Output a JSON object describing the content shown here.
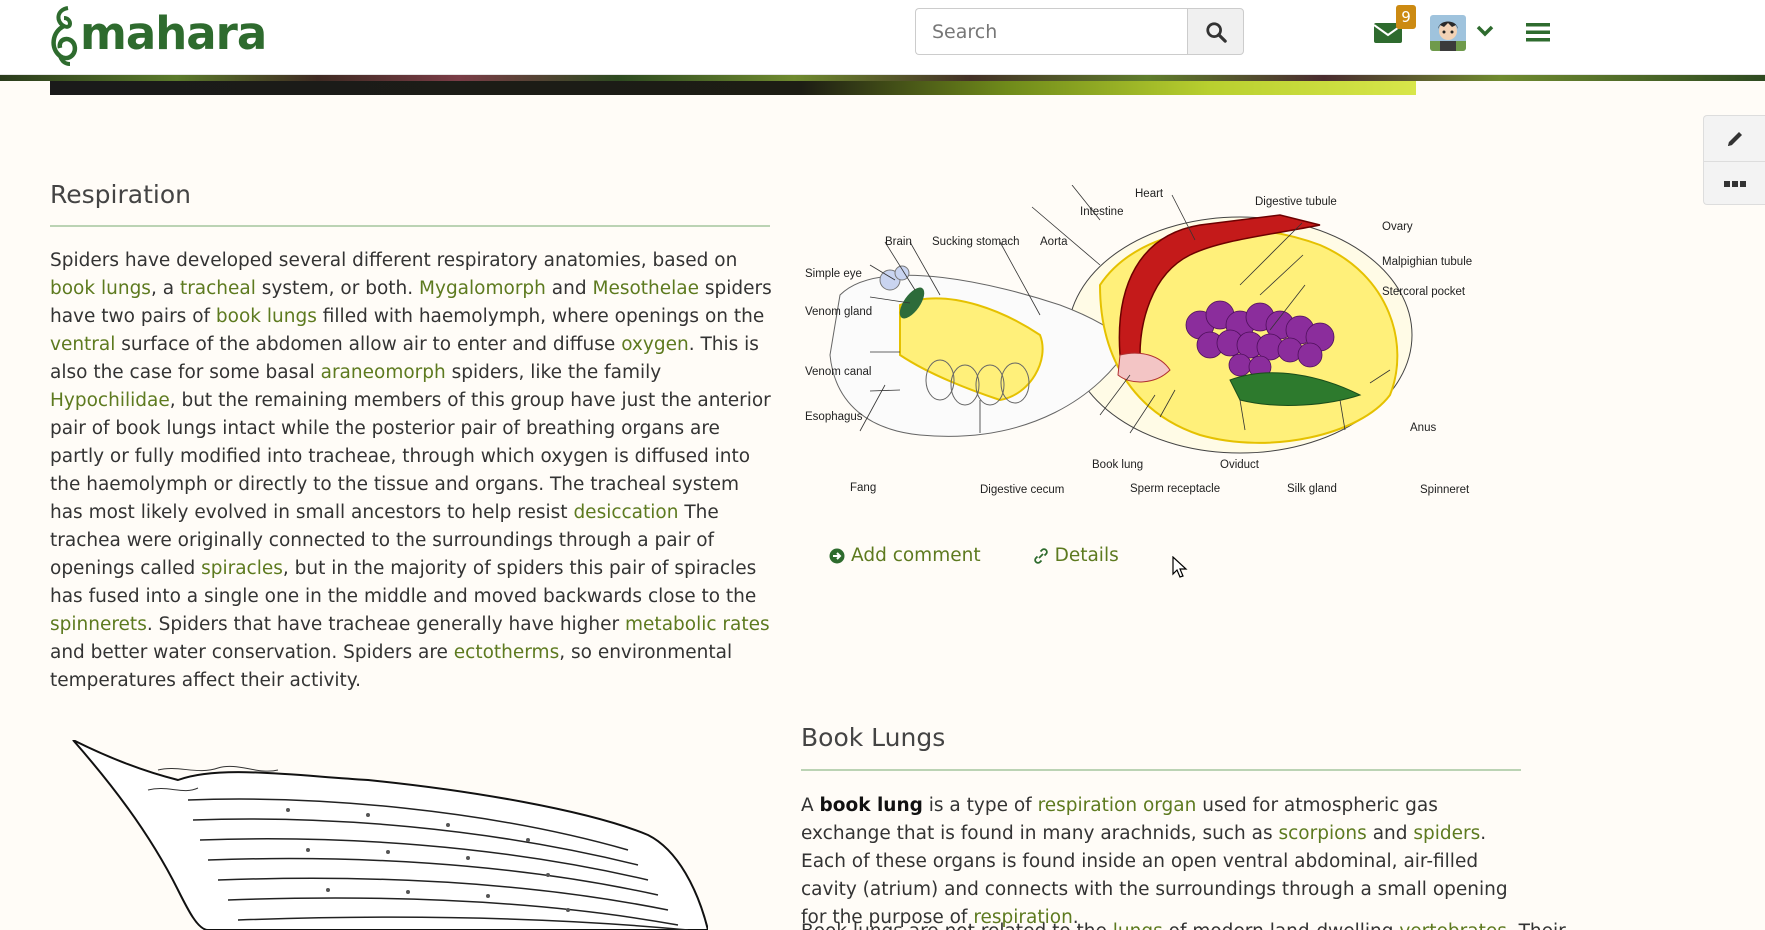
{
  "header": {
    "logo_text": "mahara",
    "search_placeholder": "Search",
    "mail_count": "9",
    "brand_color": "#2e6b2e",
    "badge_color": "#cc8a12"
  },
  "icons": {
    "search": "search-icon",
    "mail": "envelope-icon",
    "avatar": "user-avatar",
    "caret": "chevron-down-icon",
    "menu": "hamburger-icon",
    "edit": "pencil-icon",
    "more": "more-icon",
    "comment": "arrow-circle-right-icon",
    "details": "link-icon"
  },
  "respiration": {
    "title": "Respiration",
    "p1": "Spiders have developed several different respiratory anatomies, based on ",
    "l_book_lungs": "book lungs",
    "p2": ", a ",
    "l_tracheal": "tracheal",
    "p3": " system, or both. ",
    "l_mygalomorph": "Mygalomorph",
    "p4": " and ",
    "l_mesothelae": "Mesothelae",
    "p5": " spiders have two pairs of ",
    "l_book_lungs2": "book lungs",
    "p6": " filled with haemolymph, where openings on the ",
    "l_ventral": "ventral",
    "p7": " surface of the abdomen allow air to enter and diffuse ",
    "l_oxygen": "oxygen",
    "p8": ". This is also the case for some basal ",
    "l_araneomorph": "araneomorph",
    "p9": " spiders, like the family ",
    "l_hypochilidae": "Hypochilidae",
    "p10": ", but the remaining members of this group have just the anterior pair of book lungs intact while the posterior pair of breathing organs are partly or fully modified into tracheae, through which oxygen is diffused into the haemolymph or directly to the tissue and organs. The tracheal system has most likely evolved in small ancestors to help resist ",
    "l_desiccation": "desiccation",
    "p11": " The trachea were originally connected to the surroundings through a pair of openings called ",
    "l_spiracles": "spiracles",
    "p12": ", but in the majority of spiders this pair of spiracles has fused into a single one in the middle and moved backwards close to the ",
    "l_spinnerets": "spinnerets",
    "p13": ". Spiders that have tracheae generally have higher ",
    "l_metabolic": "metabolic rates",
    "p14": " and better water conservation. Spiders are ",
    "l_ectotherms": "ectotherms",
    "p15": ", so environmental temperatures affect their activity."
  },
  "diagram": {
    "labels": {
      "heart": "Heart",
      "digestive_tubule": "Digestive tubule",
      "intestine": "Intestine",
      "ovary": "Ovary",
      "brain": "Brain",
      "sucking_stomach": "Sucking stomach",
      "aorta": "Aorta",
      "malpighian_tubule": "Malpighian tubule",
      "simple_eye": "Simple eye",
      "stercoral_pocket": "Stercoral pocket",
      "venom_gland": "Venom gland",
      "venom_canal": "Venom canal",
      "esophagus": "Esophagus",
      "anus": "Anus",
      "book_lung": "Book lung",
      "oviduct": "Oviduct",
      "fang": "Fang",
      "digestive_cecum": "Digestive cecum",
      "sperm_receptacle": "Sperm receptacle",
      "silk_gland": "Silk gland",
      "spinneret": "Spinneret"
    }
  },
  "actions": {
    "add_comment": "Add comment",
    "details": "Details"
  },
  "book_lungs": {
    "title": "Book Lungs",
    "p1": "A ",
    "b1": "book lung",
    "p2": " is a type of ",
    "l_resp_organ": "respiration organ",
    "p3": " used for atmospheric gas exchange that is found in many arachnids, such as ",
    "l_scorpions": "scorpions",
    "p4": " and ",
    "l_spiders": "spiders",
    "p5": ". Each of these organs is found inside an open ventral abdominal, air-filled cavity (atrium) and connects with the surroundings through a small opening for the purpose of ",
    "l_respiration": "respiration",
    "p6": ".",
    "q1": "Book lungs are not related to the ",
    "l_lungs": "lungs",
    "q2": " of modern land-dwelling ",
    "l_vertebrates": "vertebrates",
    "q3": ". Their"
  }
}
